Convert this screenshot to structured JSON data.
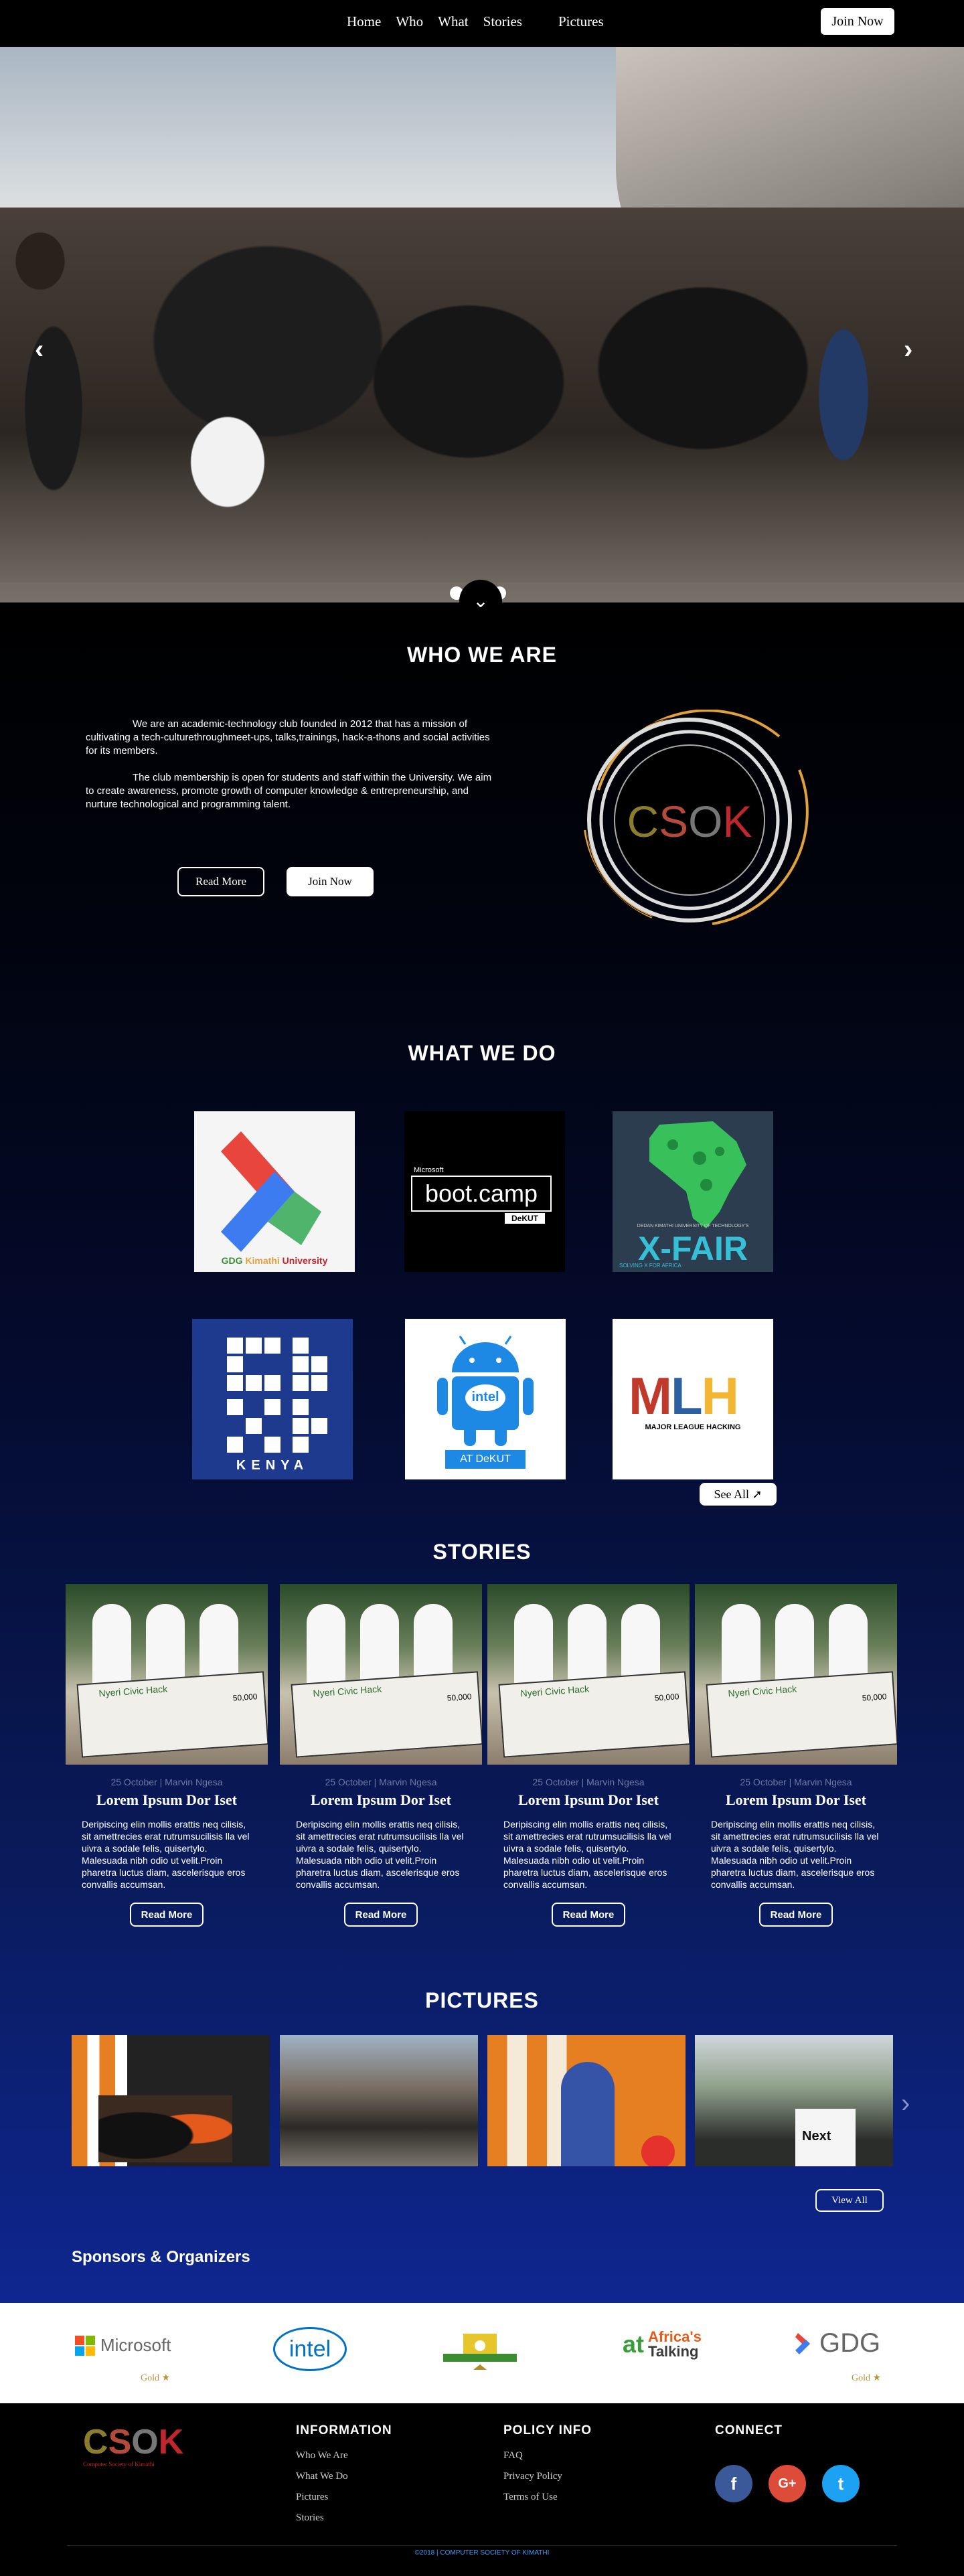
{
  "nav": {
    "links": [
      "Home",
      "Who",
      "What",
      "Stories",
      "Pictures"
    ],
    "join": "Join Now"
  },
  "hero": {
    "arrow_left": "‹",
    "arrow_right": "›",
    "scroll_down": "⌄"
  },
  "who": {
    "title": "WHO WE ARE",
    "p1": "We are an academic-technology club founded in 2012 that has a mission of cultivating a tech-culturethroughmeet-ups, talks,trainings, hack-a-thons and social activities for its members.",
    "p2": "The club membership is open for students and staff within the University. We aim to create awareness, promote growth of computer knowledge & entrepreneurship, and nurture technological and programming talent.",
    "read_more": "Read More",
    "join": "Join Now",
    "logo_text": "CSOK"
  },
  "what": {
    "title": "WHAT WE DO",
    "tiles": {
      "gdg": {
        "label_a": "GDG",
        "label_b": "Kimathi",
        "label_c": "University"
      },
      "bootcamp": {
        "brand": "Microsoft",
        "title": "boot.camp",
        "sub": "DeKUT"
      },
      "xfair": {
        "title": "X-FAIR",
        "sub": "SOLVING X FOR AFRICA",
        "top": "DEDAN KIMATHI UNIVERSITY OF TECHNOLOGY'S"
      },
      "ck": {
        "title": "KENYA"
      },
      "android": {
        "badge": "intel",
        "sub": "AT DeKUT"
      },
      "mlh": {
        "title": "MLH",
        "sub": "MAJOR LEAGUE HACKING"
      }
    },
    "see_all": "See All"
  },
  "stories": {
    "title": "STORIES",
    "cards": [
      {
        "meta": "25 October | Marvin Ngesa",
        "title": "Lorem Ipsum Dor Iset",
        "body": "Deripiscing elin mollis erattis neq cilisis, sit amettrecies erat rutrumsucilisis lla vel uivra a sodale felis, quisertylo. Malesuada nibh odio ut velit.Proin pharetra luctus diam, ascelerisque eros convallis accumsan.",
        "button": "Read More",
        "banner": "Nyeri Civic Hack",
        "amount": "50,000"
      },
      {
        "meta": "25 October | Marvin Ngesa",
        "title": "Lorem Ipsum Dor Iset",
        "body": "Deripiscing elin mollis erattis neq cilisis, sit amettrecies erat rutrumsucilisis lla vel uivra a sodale felis, quisertylo. Malesuada nibh odio ut velit.Proin pharetra luctus diam, ascelerisque eros convallis accumsan.",
        "button": "Read More",
        "banner": "Nyeri Civic Hack",
        "amount": "50,000"
      },
      {
        "meta": "25 October | Marvin Ngesa",
        "title": "Lorem Ipsum Dor Iset",
        "body": "Deripiscing elin mollis erattis neq cilisis, sit amettrecies erat rutrumsucilisis lla vel uivra a sodale felis, quisertylo. Malesuada nibh odio ut velit.Proin pharetra luctus diam, ascelerisque eros convallis accumsan.",
        "button": "Read More",
        "banner": "Nyeri Civic Hack",
        "amount": "50,000"
      },
      {
        "meta": "25 October | Marvin Ngesa",
        "title": "Lorem Ipsum Dor Iset",
        "body": "Deripiscing elin mollis erattis neq cilisis, sit amettrecies erat rutrumsucilisis lla vel uivra a sodale felis, quisertylo. Malesuada nibh odio ut velit.Proin pharetra luctus diam, ascelerisque eros convallis accumsan.",
        "button": "Read More",
        "banner": "Nyeri Civic Hack",
        "amount": "50,000"
      }
    ]
  },
  "pictures": {
    "title": "PICTURES",
    "view_all": "View All",
    "arrow": "›",
    "shirt_text": "Next"
  },
  "sponsors": {
    "title": "Sponsors & Organizers",
    "microsoft": "Microsoft",
    "intel": "intel",
    "africas_talking_a": "Africa's",
    "africas_talking_b": "Talking",
    "gdg": "GDG",
    "gold": "Gold"
  },
  "footer": {
    "logo": "CSOK",
    "logo_sub": "Computer Society of Kimathi",
    "information": {
      "title": "INFORMATION",
      "links": [
        "Who We Are",
        "What We Do",
        "Pictures",
        "Stories"
      ]
    },
    "policy": {
      "title": "POLICY INFO",
      "links": [
        "FAQ",
        "Privacy Policy",
        "Terms of Use"
      ]
    },
    "connect": {
      "title": "CONNECT",
      "icons": [
        "f",
        "G+",
        "t"
      ]
    },
    "copyright": "©2018 | COMPUTER SOCIETY OF KIMATHI"
  },
  "colors": {
    "accent_gold": "#e1a23a",
    "navy": "#0e2690",
    "facebook": "#3b5998",
    "google": "#dd4b39",
    "twitter": "#1da1f2"
  }
}
